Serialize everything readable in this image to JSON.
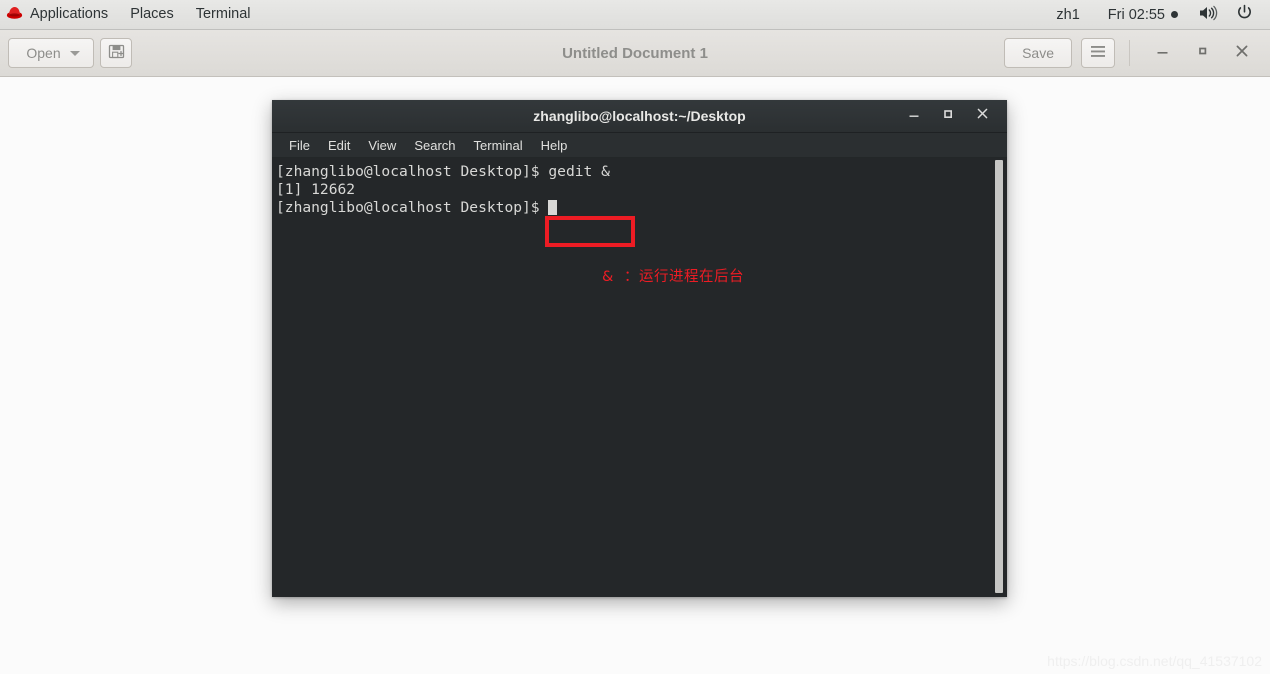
{
  "top_panel": {
    "applications_label": "Applications",
    "places_label": "Places",
    "terminal_label": "Terminal",
    "redhat_icon": "redhat-logo-icon",
    "user_label": "zh1",
    "clock_label": "Fri 02:55",
    "clock_dot_icon": "notification-dot-icon",
    "volume_icon": "volume-speaker-icon",
    "power_icon": "power-button-icon"
  },
  "gedit": {
    "title": "Untitled Document 1",
    "open_label": "Open",
    "open_caret_icon": "chevron-down-icon",
    "save_as_icon": "save-as-floppy-icon",
    "save_label": "Save",
    "menu_icon": "hamburger-menu-icon",
    "minimize_icon": "minimize-icon",
    "maximize_icon": "maximize-icon",
    "close_icon": "close-icon"
  },
  "terminal": {
    "title": "zhanglibo@localhost:~/Desktop",
    "minimize_icon": "minimize-icon",
    "maximize_icon": "maximize-icon",
    "close_icon": "close-icon",
    "menubar": [
      {
        "label": "File"
      },
      {
        "label": "Edit"
      },
      {
        "label": "View"
      },
      {
        "label": "Search"
      },
      {
        "label": "Terminal"
      },
      {
        "label": "Help"
      }
    ],
    "prompt": "[zhanglibo@localhost Desktop]$ ",
    "lines": [
      "[zhanglibo@localhost Desktop]$ gedit &",
      "[1] 12662",
      "[zhanglibo@localhost Desktop]$ "
    ],
    "screen_text": "[zhanglibo@localhost Desktop]$ gedit &\n[1] 12662\n[zhanglibo@localhost Desktop]$ ",
    "annotation": "&  ：运行进程在后台",
    "highlight_color": "#ed1c24",
    "background_color": "#242729",
    "foreground_color": "#d8d8d6"
  },
  "watermark": {
    "text": "https://blog.csdn.net/qq_41537102"
  }
}
